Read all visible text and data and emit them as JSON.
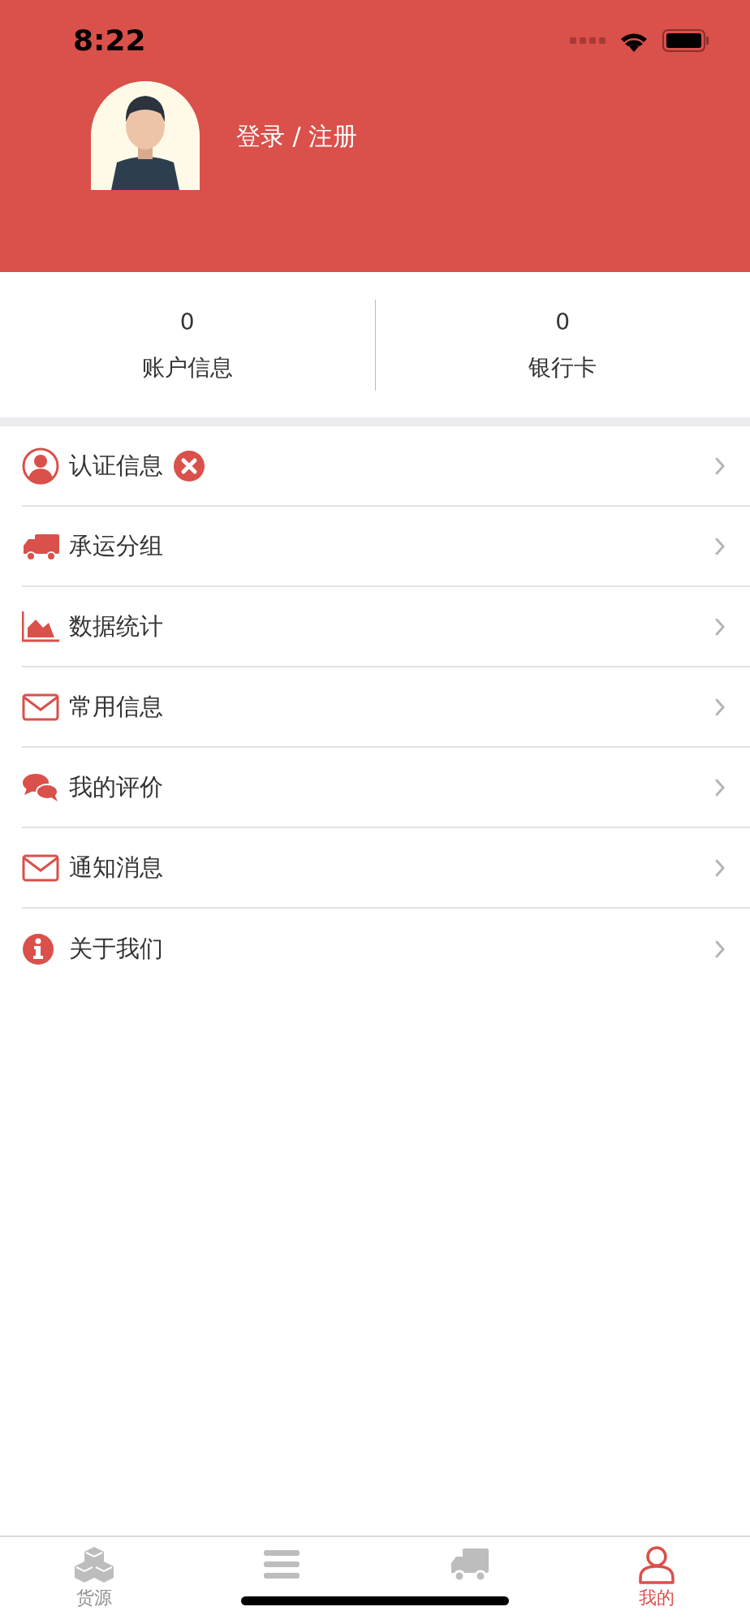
{
  "status_bar": {
    "time": "8:22"
  },
  "profile": {
    "login_text": "登录 / 注册"
  },
  "stats": [
    {
      "value": "0",
      "label": "账户信息"
    },
    {
      "value": "0",
      "label": "银行卡"
    }
  ],
  "menu": [
    {
      "label": "认证信息",
      "error_badge": true
    },
    {
      "label": "承运分组",
      "error_badge": false
    },
    {
      "label": "数据统计",
      "error_badge": false
    },
    {
      "label": "常用信息",
      "error_badge": false
    },
    {
      "label": "我的评价",
      "error_badge": false
    },
    {
      "label": "通知消息",
      "error_badge": false
    },
    {
      "label": "关于我们",
      "error_badge": false
    }
  ],
  "tab_bar": [
    {
      "label": "货源",
      "selected": false
    },
    {
      "selected": false
    },
    {
      "selected": false
    },
    {
      "label": "我的",
      "selected": true
    }
  ]
}
